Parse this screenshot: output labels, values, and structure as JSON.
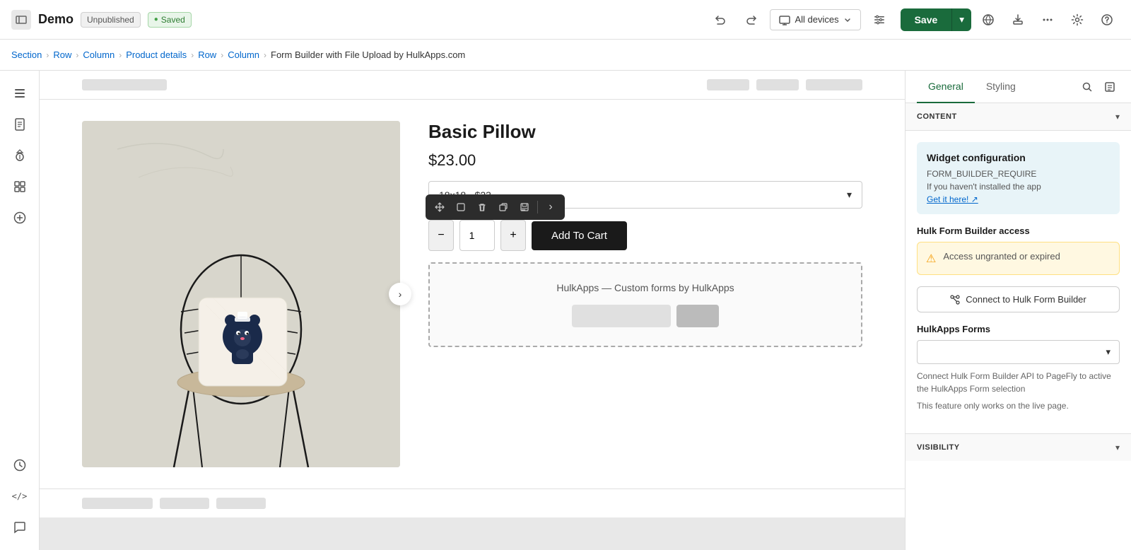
{
  "header": {
    "logo_label": "←",
    "app_name": "Demo",
    "badge_unpublished": "Unpublished",
    "badge_saved": "Saved",
    "device_btn": "All devices",
    "save_btn": "Save",
    "undo_icon": "↩",
    "redo_icon": "↪",
    "preview_icon": "👁",
    "export_icon": "⬆",
    "more_icon": "···",
    "settings_icon": "⚙",
    "help_icon": "?"
  },
  "breadcrumb": {
    "items": [
      {
        "label": "Section",
        "link": true
      },
      {
        "label": "Row",
        "link": true
      },
      {
        "label": "Column",
        "link": true
      },
      {
        "label": "Product details",
        "link": true
      },
      {
        "label": "Row",
        "link": true
      },
      {
        "label": "Column",
        "link": true
      },
      {
        "label": "Form Builder with File Upload by HulkApps.com",
        "link": false
      }
    ]
  },
  "left_sidebar": {
    "icons": [
      {
        "name": "layers-icon",
        "symbol": "☰",
        "active": false
      },
      {
        "name": "pages-icon",
        "symbol": "📄",
        "active": false
      },
      {
        "name": "apps-icon",
        "symbol": "🛍",
        "active": false
      },
      {
        "name": "grid-icon",
        "symbol": "⊞",
        "active": false
      },
      {
        "name": "add-icon",
        "symbol": "+",
        "active": false
      }
    ],
    "bottom_icons": [
      {
        "name": "history-icon",
        "symbol": "🕐"
      },
      {
        "name": "code-icon",
        "symbol": "</>"
      },
      {
        "name": "chat-icon",
        "symbol": "💬"
      }
    ]
  },
  "canvas": {
    "skeleton_widths": [
      120,
      60,
      60,
      80
    ],
    "bottom_skeleton_widths": [
      100,
      70,
      70
    ]
  },
  "product": {
    "title": "Basic Pillow",
    "price": "$23.00",
    "variant_label": "18x18 - $23",
    "add_to_cart": "Add To Cart",
    "next_btn": "›",
    "hulk_form_label": "HulkApps — Custom forms by HulkApps"
  },
  "toolbar": {
    "move_icon": "✥",
    "copy_icon": "⎘",
    "delete_icon": "🗑",
    "duplicate_icon": "⊡",
    "save_icon": "💾",
    "more_icon": "›"
  },
  "right_panel": {
    "tabs": [
      {
        "label": "General",
        "active": true
      },
      {
        "label": "Styling",
        "active": false
      }
    ],
    "search_icon": "🔍",
    "content_icon": "📄",
    "section_header": "CONTENT",
    "widget_config": {
      "title": "Widget configuration",
      "line1": "FORM_BUILDER_REQUIRE",
      "line2": "If you haven't installed the app",
      "link_text": "Get it here! ↗"
    },
    "access_section": {
      "title": "Hulk Form Builder access",
      "warning_text": "Access ungranted or expired"
    },
    "connect_btn": "Connect to Hulk Form Builder",
    "forms_section": {
      "title": "HulkApps Forms",
      "placeholder": "",
      "help_text": "Connect Hulk Form Builder API to PageFly to active the HulkApps Form selection",
      "note_text": "This feature only works on the live page."
    },
    "visibility_title": "VISIBILITY"
  }
}
